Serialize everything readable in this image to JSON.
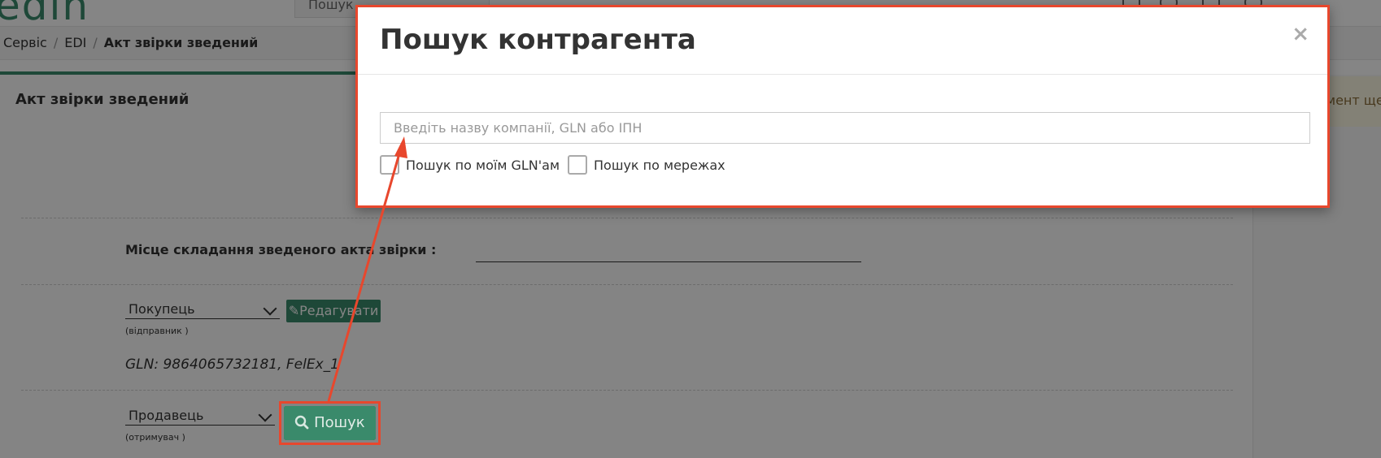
{
  "header": {
    "search_text": "Пошук",
    "logo_text": "edin"
  },
  "breadcrumb": {
    "items": [
      "Сервіс",
      "EDI"
    ],
    "separator": "/",
    "current": "Акт звірки зведений"
  },
  "page": {
    "title": "Акт звірки зведений",
    "notice_text": "мент ще"
  },
  "form": {
    "place_label": "Місце складання зведеного акта звірки :",
    "buyer": {
      "selected": "Покупець",
      "note": "(відправник )",
      "edit_label": "Редагувати"
    },
    "gln_info": "GLN: 9864065732181, FelEx_1",
    "seller": {
      "selected": "Продавець",
      "note": "(отримувач )",
      "search_label": "Пошук"
    }
  },
  "modal": {
    "title": "Пошук контрагента",
    "close": "×",
    "input_placeholder": "Введіть назву компанії, GLN або ІПН",
    "checkbox_my_gln": "Пошук по моїм GLN'ам",
    "checkbox_networks": "Пошук по мережах"
  },
  "colors": {
    "accent": "#3a8a6b",
    "highlight": "#e8472d"
  }
}
